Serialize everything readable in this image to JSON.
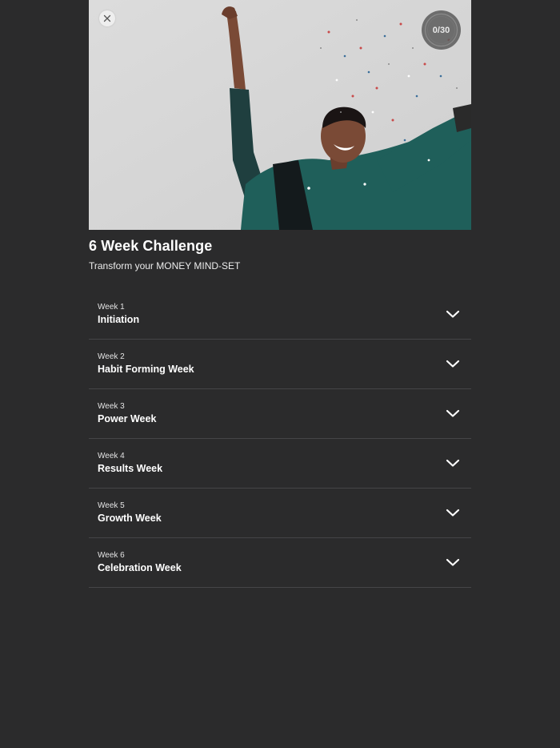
{
  "header": {
    "close_icon": "close-icon",
    "progress": {
      "text": "0/30",
      "value": 0,
      "total": 30
    }
  },
  "challenge": {
    "title": "6 Week Challenge",
    "subtitle": "Transform your MONEY MIND-SET"
  },
  "weeks": [
    {
      "number_label": "Week 1",
      "name": "Initiation"
    },
    {
      "number_label": "Week 2",
      "name": "Habit Forming Week"
    },
    {
      "number_label": "Week 3",
      "name": "Power Week"
    },
    {
      "number_label": "Week 4",
      "name": "Results Week"
    },
    {
      "number_label": "Week 5",
      "name": "Growth Week"
    },
    {
      "number_label": "Week 6",
      "name": "Celebration Week"
    }
  ],
  "colors": {
    "background": "#2b2b2c",
    "divider": "#454547",
    "text": "#ffffff",
    "jacket": "#1f5f5a"
  }
}
